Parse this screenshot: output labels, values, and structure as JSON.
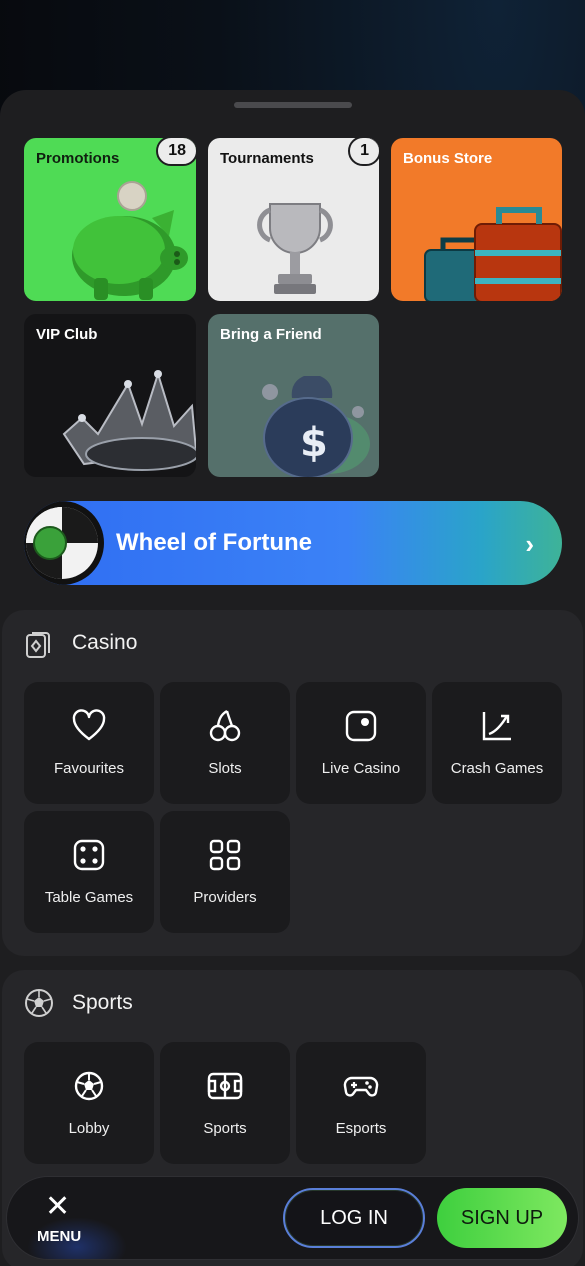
{
  "quick_tiles": [
    {
      "label": "Promotions",
      "badge": "18",
      "bg": "#4fdb55"
    },
    {
      "label": "Tournaments",
      "badge": "1",
      "bg": "#ebebeb"
    },
    {
      "label": "Bonus Store",
      "badge": null,
      "bg": "#f27a29"
    },
    {
      "label": "VIP Club",
      "badge": null,
      "bg": "#141416"
    },
    {
      "label": "Bring a Friend",
      "badge": null,
      "bg": "#55706b"
    }
  ],
  "wheel_banner": {
    "title": "Wheel of Fortune",
    "arrow": "›"
  },
  "casino": {
    "title": "Casino",
    "items": [
      {
        "label": "Favourites",
        "icon": "heart-icon"
      },
      {
        "label": "Slots",
        "icon": "cherries-icon"
      },
      {
        "label": "Live Casino",
        "icon": "live-icon"
      },
      {
        "label": "Crash Games",
        "icon": "chart-up-icon"
      },
      {
        "label": "Table Games",
        "icon": "dice-icon"
      },
      {
        "label": "Providers",
        "icon": "grid-icon"
      }
    ]
  },
  "sports": {
    "title": "Sports",
    "items": [
      {
        "label": "Lobby",
        "icon": "football-icon"
      },
      {
        "label": "Sports",
        "icon": "pitch-icon"
      },
      {
        "label": "Esports",
        "icon": "gamepad-icon"
      }
    ]
  },
  "bottom_bar": {
    "menu_label": "MENU",
    "close_glyph": "✕",
    "login_label": "LOG IN",
    "signup_label": "SIGN UP"
  }
}
